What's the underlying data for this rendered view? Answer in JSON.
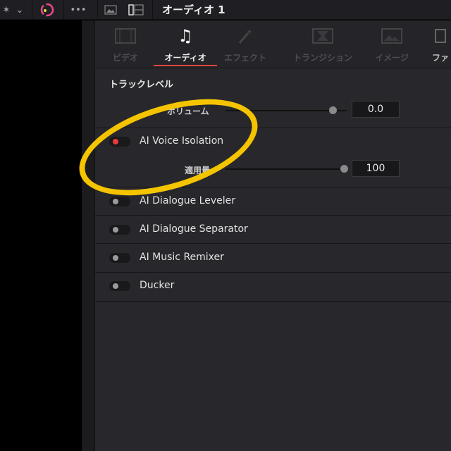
{
  "topbar": {
    "title": "オーディオ 1",
    "more_label": "•••",
    "icons": [
      "effects-icon",
      "chevron-down-icon",
      "color-wheel-icon",
      "more-icon",
      "viewer-icon",
      "layout-icon"
    ]
  },
  "tabs": [
    {
      "label": "ビデオ",
      "icon": "film-icon",
      "active": false
    },
    {
      "label": "オーディオ",
      "icon": "music-note-icon",
      "active": true
    },
    {
      "label": "エフェクト",
      "icon": "magic-wand-icon",
      "active": false
    },
    {
      "label": "トランジション",
      "icon": "transition-icon",
      "active": false
    },
    {
      "label": "イメージ",
      "icon": "image-icon",
      "active": false
    },
    {
      "label": "ファ",
      "icon": "file-icon",
      "active": false
    }
  ],
  "accent": "#e0443e",
  "section": {
    "title": "トラックレベル",
    "volume": {
      "label": "ボリューム",
      "value": "0.0"
    }
  },
  "features": [
    {
      "label": "AI Voice Isolation",
      "enabled": true,
      "amount_label": "適用量",
      "amount": "100"
    },
    {
      "label": "AI Dialogue Leveler",
      "enabled": false
    },
    {
      "label": "AI Dialogue Separator",
      "enabled": false
    },
    {
      "label": "AI Music Remixer",
      "enabled": false
    },
    {
      "label": "Ducker",
      "enabled": false
    }
  ],
  "annotation_color": "#f5c400"
}
